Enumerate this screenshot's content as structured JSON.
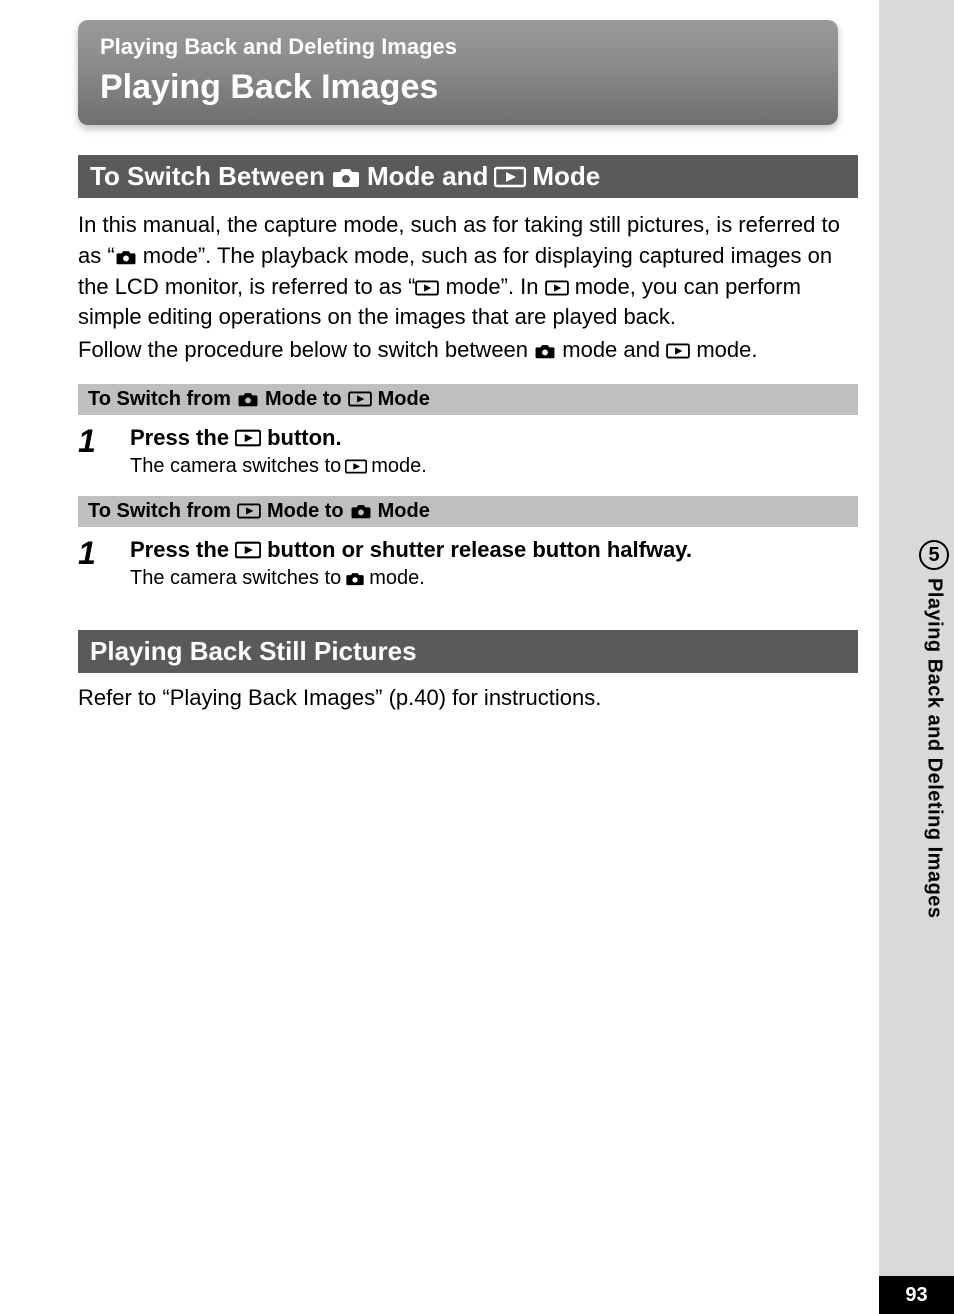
{
  "banner": {
    "subtitle": "Playing Back and Deleting Images",
    "title": "Playing Back Images"
  },
  "section1": {
    "bar_prefix": "To Switch Between",
    "bar_mid": "Mode and",
    "bar_suffix": "Mode",
    "para1_a": "In this manual, the capture mode, such as for taking still pictures, is referred to as “",
    "para1_b": " mode”. The playback mode, such as for displaying captured images on the LCD monitor, is referred to as “",
    "para1_c": " mode”. In ",
    "para1_d": " mode, you can perform simple editing operations on the images that are played back.",
    "para2_a": "Follow the procedure below to switch between ",
    "para2_b": " mode and ",
    "para2_c": " mode.",
    "sub1_prefix": "To Switch from",
    "sub1_mid": "Mode to",
    "sub1_suffix": "Mode",
    "step1_num": "1",
    "step1_title_a": "Press the",
    "step1_title_b": "button.",
    "step1_desc_a": "The camera switches to",
    "step1_desc_b": "mode.",
    "sub2_prefix": "To Switch from",
    "sub2_mid": "Mode to",
    "sub2_suffix": "Mode",
    "step2_num": "1",
    "step2_title_a": "Press the",
    "step2_title_b": "button or shutter release button halfway.",
    "step2_desc_a": "The camera switches to",
    "step2_desc_b": "mode."
  },
  "section2": {
    "bar": "Playing Back Still Pictures",
    "ref": "Refer to “Playing Back Images” (p.40) for instructions."
  },
  "side": {
    "chapter": "5",
    "label": "Playing Back and Deleting Images"
  },
  "page_number": "93"
}
